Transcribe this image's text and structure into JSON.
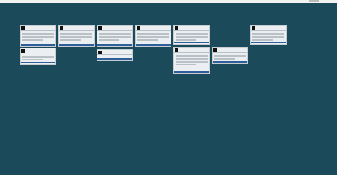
{
  "cards": [
    {
      "account": "",
      "date": "",
      "body": ""
    },
    {
      "account": "",
      "date": "",
      "body": ""
    },
    {
      "account": "",
      "date": "",
      "body": ""
    },
    {
      "account": "",
      "date": "",
      "body": ""
    },
    {
      "account": "",
      "date": "",
      "body": ""
    },
    {
      "account": "",
      "date": "",
      "body": ""
    },
    {
      "account": "",
      "date": "",
      "body": ""
    },
    {
      "account": "",
      "date": "",
      "body": ""
    },
    {
      "account": "",
      "date": "",
      "body": ""
    },
    {
      "account": "",
      "date": "",
      "body": ""
    }
  ]
}
